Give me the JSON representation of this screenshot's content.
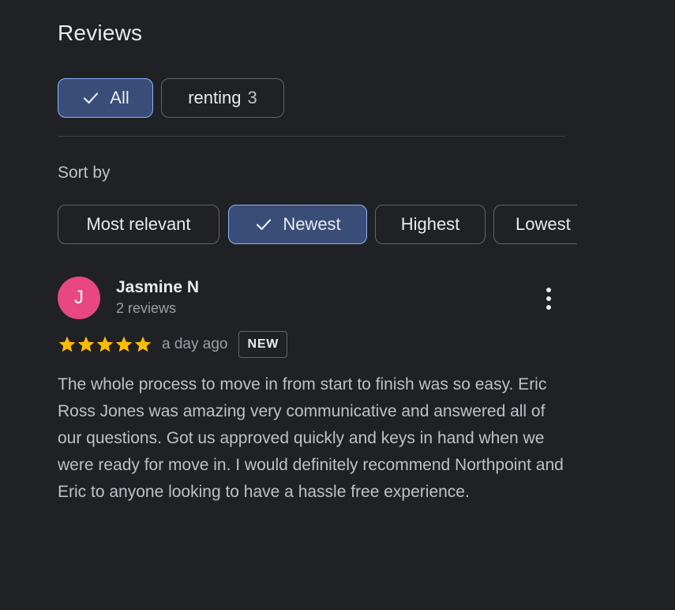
{
  "header": {
    "title": "Reviews"
  },
  "filters": {
    "chips": [
      {
        "label": "All",
        "selected": true
      },
      {
        "label": "renting",
        "count": "3",
        "selected": false
      }
    ]
  },
  "sort": {
    "label": "Sort by",
    "options": [
      {
        "label": "Most relevant",
        "selected": false
      },
      {
        "label": "Newest",
        "selected": true
      },
      {
        "label": "Highest",
        "selected": false
      },
      {
        "label": "Lowest",
        "selected": false
      }
    ]
  },
  "review": {
    "avatar_initial": "J",
    "avatar_color": "#e8487f",
    "author": "Jasmine N",
    "author_reviews": "2 reviews",
    "rating": 5,
    "rating_max": 5,
    "star_color": "#fbbc04",
    "time_ago": "a day ago",
    "badge": "NEW",
    "text": "The whole process to move in from start to finish was so easy. Eric Ross Jones was amazing very communicative and answered all of our questions. Got us approved quickly and keys in hand when we were ready for move in. I would definitely recommend Northpoint and Eric to anyone looking to have a hassle free experience.",
    "more_icon": "more-vertical-icon"
  },
  "theme": {
    "background": "#202124",
    "selected_chip_bg": "#394d78",
    "selected_chip_border": "#8ab4f8"
  }
}
